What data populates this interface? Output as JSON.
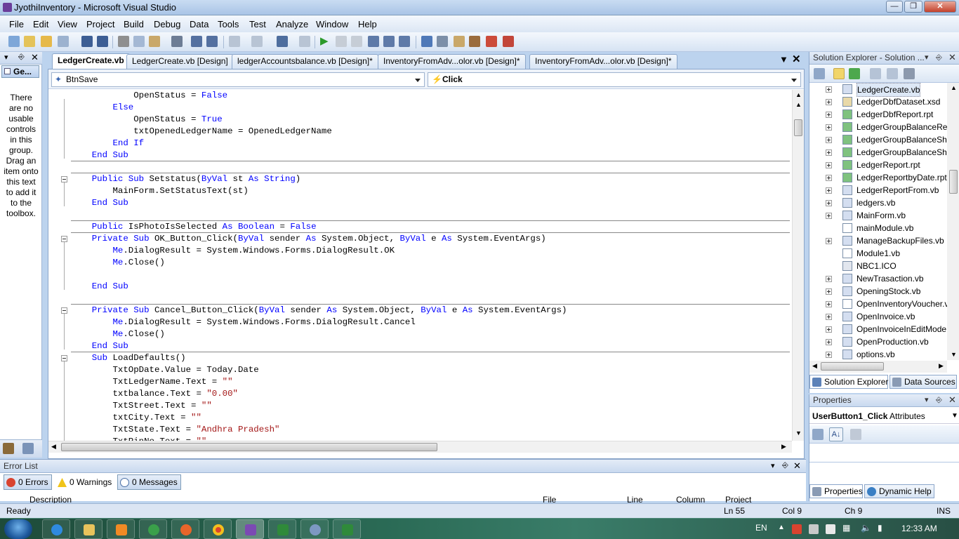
{
  "window": {
    "title": "JyothiInventory - Microsoft Visual Studio"
  },
  "menu": [
    "File",
    "Edit",
    "View",
    "Project",
    "Build",
    "Debug",
    "Data",
    "Tools",
    "Test",
    "Analyze",
    "Window",
    "Help"
  ],
  "toolbox": {
    "group_label": "Ge...",
    "empty_message": "There are no usable controls in this group. Drag an item onto this text to add it to the toolbox."
  },
  "tabs": [
    {
      "label": "LedgerCreate.vb",
      "active": true
    },
    {
      "label": "LedgerCreate.vb [Design]"
    },
    {
      "label": "ledgerAccountsbalance.vb [Design]*"
    },
    {
      "label": "InventoryFromAdv...olor.vb [Design]*"
    },
    {
      "label": "InventoryFromAdv...olor.vb [Design]*"
    }
  ],
  "editor": {
    "class_combo": "BtnSave",
    "method_combo": "Click",
    "lines": [
      [
        [
          "            OpenStatus = ",
          ""
        ],
        [
          "False",
          "k"
        ]
      ],
      [
        [
          "        ",
          ""
        ],
        [
          "Else",
          "k"
        ]
      ],
      [
        [
          "            OpenStatus = ",
          ""
        ],
        [
          "True",
          "k"
        ]
      ],
      [
        [
          "            txtOpenedLedgerName = OpenedLedgerName",
          ""
        ]
      ],
      [
        [
          "        ",
          ""
        ],
        [
          "End If",
          "k"
        ]
      ],
      [
        [
          "    ",
          ""
        ],
        [
          "End Sub",
          "k"
        ]
      ],
      [
        [
          "",
          ""
        ]
      ],
      [
        [
          "    ",
          ""
        ],
        [
          "Public Sub",
          "k"
        ],
        [
          " Setstatus(",
          ""
        ],
        [
          "ByVal",
          "k"
        ],
        [
          " st ",
          ""
        ],
        [
          "As String",
          "k"
        ],
        [
          ")",
          ""
        ]
      ],
      [
        [
          "        MainForm.SetStatusText(st)",
          ""
        ]
      ],
      [
        [
          "    ",
          ""
        ],
        [
          "End Sub",
          "k"
        ]
      ],
      [
        [
          "",
          ""
        ]
      ],
      [
        [
          "    ",
          ""
        ],
        [
          "Public",
          "k"
        ],
        [
          " IsPhotoIsSelected ",
          ""
        ],
        [
          "As Boolean",
          "k"
        ],
        [
          " = ",
          ""
        ],
        [
          "False",
          "k"
        ]
      ],
      [
        [
          "    ",
          ""
        ],
        [
          "Private Sub",
          "k"
        ],
        [
          " OK_Button_Click(",
          ""
        ],
        [
          "ByVal",
          "k"
        ],
        [
          " sender ",
          ""
        ],
        [
          "As",
          "k"
        ],
        [
          " System.Object, ",
          ""
        ],
        [
          "ByVal",
          "k"
        ],
        [
          " e ",
          ""
        ],
        [
          "As",
          "k"
        ],
        [
          " System.EventArgs)",
          ""
        ]
      ],
      [
        [
          "        ",
          ""
        ],
        [
          "Me",
          "k"
        ],
        [
          ".DialogResult = System.Windows.Forms.DialogResult.OK",
          ""
        ]
      ],
      [
        [
          "        ",
          ""
        ],
        [
          "Me",
          "k"
        ],
        [
          ".Close()",
          ""
        ]
      ],
      [
        [
          "",
          ""
        ]
      ],
      [
        [
          "    ",
          ""
        ],
        [
          "End Sub",
          "k"
        ]
      ],
      [
        [
          "",
          ""
        ]
      ],
      [
        [
          "    ",
          ""
        ],
        [
          "Private Sub",
          "k"
        ],
        [
          " Cancel_Button_Click(",
          ""
        ],
        [
          "ByVal",
          "k"
        ],
        [
          " sender ",
          ""
        ],
        [
          "As",
          "k"
        ],
        [
          " System.Object, ",
          ""
        ],
        [
          "ByVal",
          "k"
        ],
        [
          " e ",
          ""
        ],
        [
          "As",
          "k"
        ],
        [
          " System.EventArgs)",
          ""
        ]
      ],
      [
        [
          "        ",
          ""
        ],
        [
          "Me",
          "k"
        ],
        [
          ".DialogResult = System.Windows.Forms.DialogResult.Cancel",
          ""
        ]
      ],
      [
        [
          "        ",
          ""
        ],
        [
          "Me",
          "k"
        ],
        [
          ".Close()",
          ""
        ]
      ],
      [
        [
          "    ",
          ""
        ],
        [
          "End Sub",
          "k"
        ]
      ],
      [
        [
          "    ",
          ""
        ],
        [
          "Sub",
          "k"
        ],
        [
          " LoadDefaults()",
          ""
        ]
      ],
      [
        [
          "        TxtOpDate.Value = Today.Date",
          ""
        ]
      ],
      [
        [
          "        TxtLedgerName.Text = ",
          ""
        ],
        [
          "\"\"",
          "s"
        ]
      ],
      [
        [
          "        txtbalance.Text = ",
          ""
        ],
        [
          "\"0.00\"",
          "s"
        ]
      ],
      [
        [
          "        TxtStreet.Text = ",
          ""
        ],
        [
          "\"\"",
          "s"
        ]
      ],
      [
        [
          "        txtCity.Text = ",
          ""
        ],
        [
          "\"\"",
          "s"
        ]
      ],
      [
        [
          "        TxtState.Text = ",
          ""
        ],
        [
          "\"Andhra Pradesh\"",
          "s"
        ]
      ],
      [
        [
          "        TxtPinNo.Text = ",
          ""
        ],
        [
          "\"\"",
          "s"
        ]
      ]
    ]
  },
  "solution_explorer": {
    "title": "Solution Explorer - Solution ...",
    "items": [
      {
        "label": "LedgerCreate.vb",
        "expandable": true,
        "selected": true
      },
      {
        "label": "LedgerDbfDataset.xsd",
        "expandable": true
      },
      {
        "label": "LedgerDbfReport.rpt",
        "expandable": true
      },
      {
        "label": "LedgerGroupBalanceRep",
        "expandable": true
      },
      {
        "label": "LedgerGroupBalanceShe",
        "expandable": true
      },
      {
        "label": "LedgerGroupBalanceShe",
        "expandable": true
      },
      {
        "label": "LedgerReport.rpt",
        "expandable": true
      },
      {
        "label": "LedgerReportbyDate.rpt",
        "expandable": true
      },
      {
        "label": "LedgerReportFrom.vb",
        "expandable": true
      },
      {
        "label": "ledgers.vb",
        "expandable": true
      },
      {
        "label": "MainForm.vb",
        "expandable": true
      },
      {
        "label": "mainModule.vb",
        "expandable": false
      },
      {
        "label": "ManageBackupFiles.vb",
        "expandable": true
      },
      {
        "label": "Module1.vb",
        "expandable": false
      },
      {
        "label": "NBC1.ICO",
        "expandable": false
      },
      {
        "label": "NewTrasaction.vb",
        "expandable": true
      },
      {
        "label": "OpeningStock.vb",
        "expandable": true
      },
      {
        "label": "OpenInventoryVoucher.v",
        "expandable": true
      },
      {
        "label": "OpenInvoice.vb",
        "expandable": true
      },
      {
        "label": "OpenInvoiceInEditMode",
        "expandable": true
      },
      {
        "label": "OpenProduction.vb",
        "expandable": true
      },
      {
        "label": "options.vb",
        "expandable": true
      }
    ],
    "bottom_tabs": [
      "Solution Explorer",
      "Data Sources"
    ]
  },
  "properties": {
    "title": "Properties",
    "object_name": "UserButton1_Click",
    "object_type": "Attributes",
    "bottom_tabs": [
      "Properties",
      "Dynamic Help"
    ]
  },
  "error_list": {
    "title": "Error List",
    "errors": "0 Errors",
    "warnings": "0 Warnings",
    "messages": "0 Messages",
    "columns": [
      "Description",
      "File",
      "Line",
      "Column",
      "Project"
    ]
  },
  "status": {
    "ready": "Ready",
    "ln": "Ln 55",
    "col": "Col 9",
    "ch": "Ch 9",
    "mode": "INS"
  },
  "tray": {
    "lang": "EN",
    "time": "12:33 AM"
  },
  "colors": {
    "keyword": "#0000ff",
    "string": "#a31515",
    "chrome": "#bcd3ee"
  }
}
